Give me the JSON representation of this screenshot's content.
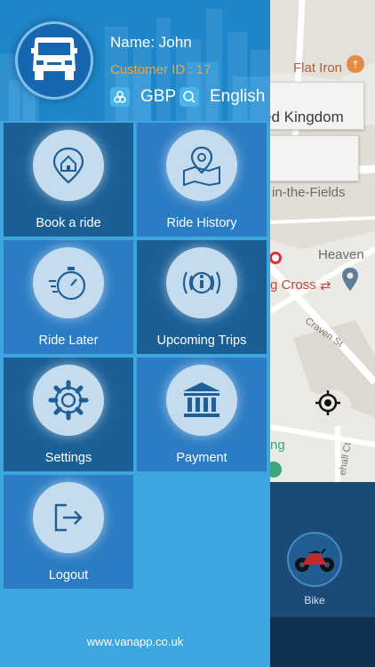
{
  "map": {
    "labels": {
      "flat_iron": "Flat Iron",
      "search_box": "ed Kingdom",
      "in_the_fields": "in-the-Fields",
      "heaven": "Heaven",
      "charing_cross": "g Cross",
      "craven_st": "Craven St",
      "ng": "ng",
      "hall_ct": "ehall Ct"
    },
    "colors": {
      "road": "#ffffff",
      "block": "#dedbd4",
      "park": "#c8e3c0"
    }
  },
  "vehicle_strip": {
    "bike_label": "Bike"
  },
  "drawer": {
    "user_name": "Name: John",
    "customer_id": "Customer ID : 17",
    "currency": "GBP",
    "language": "English",
    "colors": {
      "header": "#1e86c9",
      "body": "#3ea6de",
      "tile_dark": "#1a5f96",
      "tile_mid": "#2b7cc4",
      "accent": "#f2a33a"
    },
    "menu": [
      {
        "label": "Book a ride",
        "icon": "home-pin-icon"
      },
      {
        "label": "Ride History",
        "icon": "map-pin-icon"
      },
      {
        "label": "Ride Later",
        "icon": "stopwatch-icon"
      },
      {
        "label": "Upcoming Trips",
        "icon": "info-icon"
      },
      {
        "label": "Settings",
        "icon": "gear-icon"
      },
      {
        "label": "Payment",
        "icon": "bank-icon"
      },
      {
        "label": "Logout",
        "icon": "logout-icon"
      }
    ],
    "footer_url": "www.vanapp.co.uk"
  }
}
